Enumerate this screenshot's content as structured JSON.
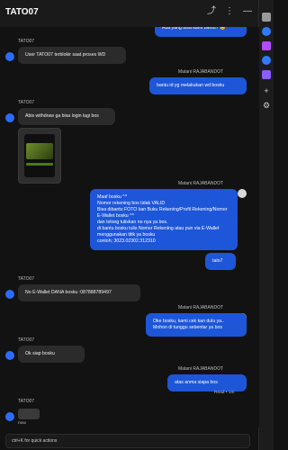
{
  "header": {
    "title": "TATO07"
  },
  "icons": {
    "link": "link-icon",
    "more": "more-icon",
    "minimize": "minimize-icon"
  },
  "messages": [
    {
      "side": "right",
      "text": "Ada yang bisa kami bantu? 😊"
    },
    {
      "side": "left",
      "name": "TATO07",
      "text": "User TATO07 terblokir saat proses WD"
    },
    {
      "side": "right",
      "name": "Matani RAJABANDOT",
      "text": "bantu id yg melakukan wd bosku"
    },
    {
      "side": "left",
      "name": "TATO07",
      "text": "Abis withdraw ga bisa login lagi bos"
    },
    {
      "side": "right",
      "name": "Matani RAJABANDOT",
      "text": "Maaf bosku ^^\nNomor rekening bos tidak VALID\nBisa dibantu FOTO kan Buku Rekening/Profil Rekening/Nomor E-Wallet bosku ^^\ndan tolong tuliskan no nya ya bos.\ndi bantu bosku tulis Nomor Rekening atau pun via E-Wallet menggunakan titik ya bosku\ncontoh; 3023.02302.312310"
    },
    {
      "side": "right",
      "text": "tato7"
    },
    {
      "side": "left",
      "name": "TATO07",
      "text": "No E-Wallet DANA bosku :087888789497"
    },
    {
      "side": "right",
      "name": "Matani RAJABANDOT",
      "text": "Oke bosku, kami cek kan dulu ya..\nMohon di tunggu sebentar ya bos"
    },
    {
      "side": "left",
      "name": "TATO07",
      "text": "Ok siap bosku"
    },
    {
      "side": "right",
      "name": "Matani RAJABANDOT",
      "text": "atas anma siapa bos"
    },
    {
      "side": "left",
      "name": "TATO07",
      "text": ""
    }
  ],
  "receipt": "Read • 1m",
  "now_label": "now",
  "quick_actions": "ctrl+K for quick actions",
  "colors": {
    "bubble_right": "#1d56d8",
    "bubble_left": "#2b2b2b",
    "background": "#121212"
  }
}
